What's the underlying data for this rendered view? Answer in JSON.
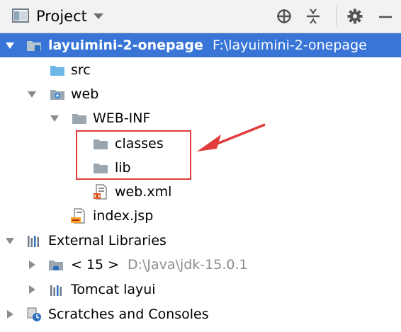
{
  "header": {
    "title": "Project",
    "icons": [
      "project-window-icon",
      "dropdown-caret-icon",
      "locate-icon",
      "collapse-all-icon",
      "gear-icon",
      "minimize-icon"
    ]
  },
  "tree": {
    "root": {
      "label": "layuimini-2-onepage",
      "path": "F:\\layuimini-2-onepage"
    },
    "src": "src",
    "web": "web",
    "webinf": "WEB-INF",
    "classes": "classes",
    "lib": "lib",
    "webxml": "web.xml",
    "indexjsp": "index.jsp",
    "extlibs": "External Libraries",
    "jdk": {
      "label": "< 15 >",
      "path": "D:\\Java\\jdk-15.0.1"
    },
    "tomcat": "Tomcat layui",
    "scratches": "Scratches and Consoles"
  },
  "colors": {
    "selection": "#3875d7",
    "annotation": "#e23b3b",
    "folder": "#9aa7b0",
    "source_folder": "#6cb8e6"
  }
}
